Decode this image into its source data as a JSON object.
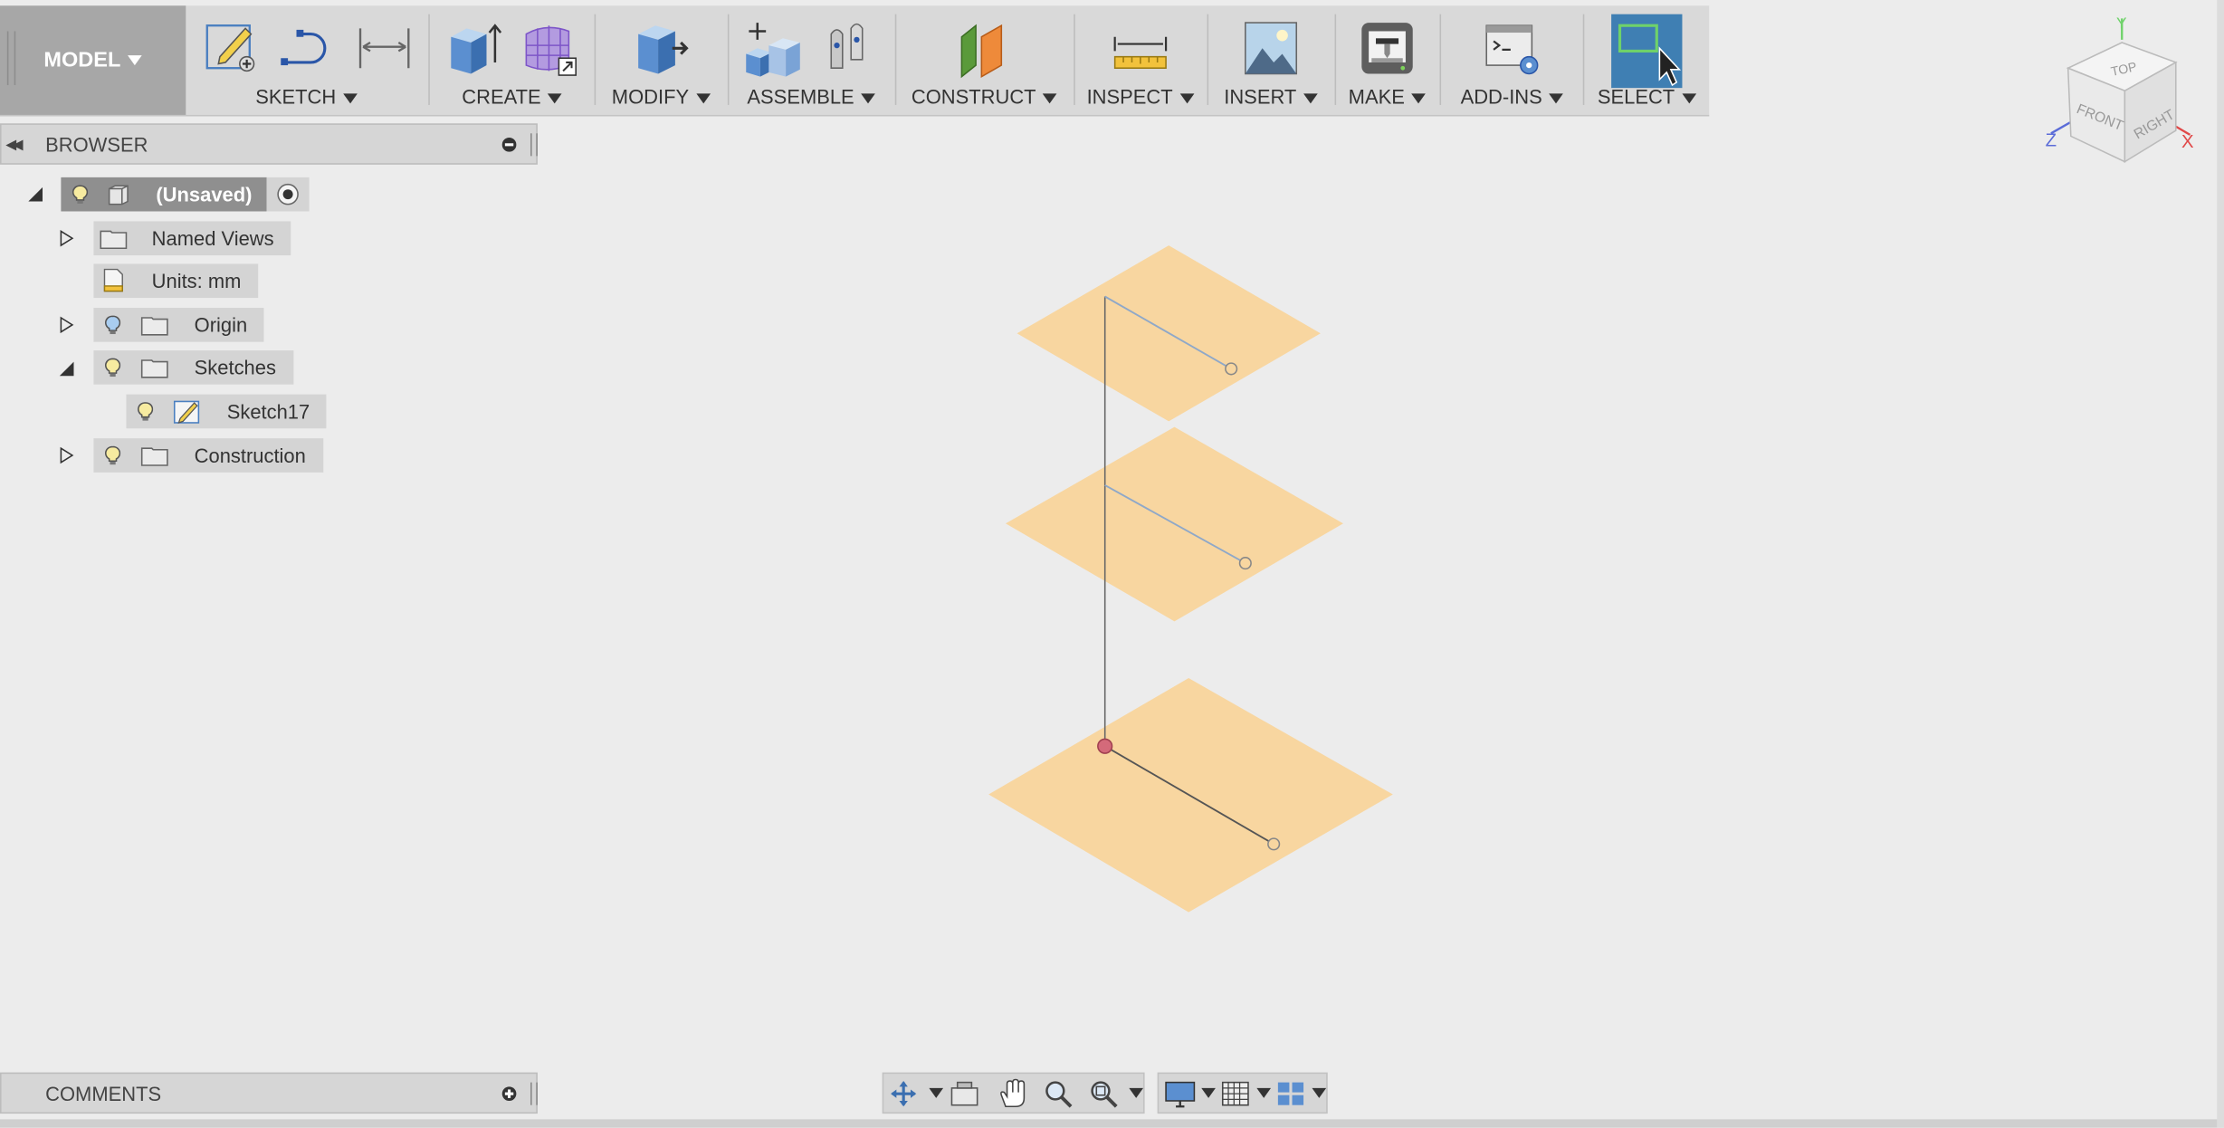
{
  "toolbar": {
    "workspace": "MODEL",
    "groups": [
      {
        "label": "SKETCH"
      },
      {
        "label": "CREATE"
      },
      {
        "label": "MODIFY"
      },
      {
        "label": "ASSEMBLE"
      },
      {
        "label": "CONSTRUCT"
      },
      {
        "label": "INSPECT"
      },
      {
        "label": "INSERT"
      },
      {
        "label": "MAKE"
      },
      {
        "label": "ADD-INS"
      },
      {
        "label": "SELECT"
      }
    ]
  },
  "browser": {
    "title": "BROWSER",
    "items": [
      {
        "label": "(Unsaved)"
      },
      {
        "label": "Named Views"
      },
      {
        "label": "Units: mm"
      },
      {
        "label": "Origin"
      },
      {
        "label": "Sketches"
      },
      {
        "label": "Sketch17"
      },
      {
        "label": "Construction"
      }
    ]
  },
  "comments": {
    "title": "COMMENTS"
  },
  "viewcube": {
    "top": "TOP",
    "front": "FRONT",
    "right": "RIGHT",
    "axis_x": "X",
    "axis_y": "Y",
    "axis_z": "Z"
  },
  "colors": {
    "plane_fill": "#f8d6a0",
    "sketch_line": "#8fa8c8",
    "accent_select": "#3f7fb3"
  }
}
